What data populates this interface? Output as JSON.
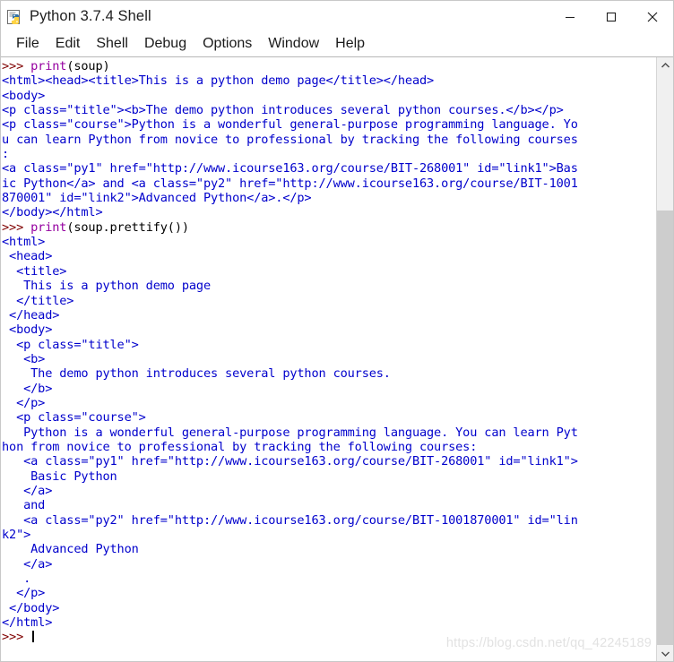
{
  "window": {
    "title": "Python 3.7.4 Shell",
    "icon": "python-idle-icon",
    "controls": [
      {
        "name": "minimize-button",
        "glyph": "—"
      },
      {
        "name": "maximize-button",
        "glyph": "□"
      },
      {
        "name": "close-button",
        "glyph": "✕"
      }
    ]
  },
  "menubar": {
    "items": [
      {
        "label": "File"
      },
      {
        "label": "Edit"
      },
      {
        "label": "Shell"
      },
      {
        "label": "Debug"
      },
      {
        "label": "Options"
      },
      {
        "label": "Window"
      },
      {
        "label": "Help"
      }
    ]
  },
  "scrollbar": {
    "up_arrow_glyph": "⌃",
    "down_arrow_glyph": "⌄",
    "thumb_top_pct": 24,
    "thumb_height_pct": 76
  },
  "watermark": {
    "text": "https://blog.csdn.net/qq_42245189"
  },
  "colors": {
    "prompt": "#7f0000",
    "keyword": "#9500a0",
    "output": "#0000cc",
    "plain": "#000000",
    "background": "#ffffff"
  },
  "shell": {
    "lines": [
      {
        "type": "input",
        "prompt": ">>> ",
        "kw": "print",
        "rest": "(soup)"
      },
      {
        "type": "output",
        "text": "<html><head><title>This is a python demo page</title></head>"
      },
      {
        "type": "output",
        "text": "<body>"
      },
      {
        "type": "output",
        "text": "<p class=\"title\"><b>The demo python introduces several python courses.</b></p>"
      },
      {
        "type": "output",
        "text": "<p class=\"course\">Python is a wonderful general-purpose programming language. Yo"
      },
      {
        "type": "output",
        "text": "u can learn Python from novice to professional by tracking the following courses"
      },
      {
        "type": "output",
        "text": ":"
      },
      {
        "type": "output",
        "text": "<a class=\"py1\" href=\"http://www.icourse163.org/course/BIT-268001\" id=\"link1\">Bas"
      },
      {
        "type": "output",
        "text": "ic Python</a> and <a class=\"py2\" href=\"http://www.icourse163.org/course/BIT-1001"
      },
      {
        "type": "output",
        "text": "870001\" id=\"link2\">Advanced Python</a>.</p>"
      },
      {
        "type": "output",
        "text": "</body></html>"
      },
      {
        "type": "input",
        "prompt": ">>> ",
        "kw": "print",
        "rest": "(soup.prettify())"
      },
      {
        "type": "output",
        "text": "<html>"
      },
      {
        "type": "output",
        "text": " <head>"
      },
      {
        "type": "output",
        "text": "  <title>"
      },
      {
        "type": "output",
        "text": "   This is a python demo page"
      },
      {
        "type": "output",
        "text": "  </title>"
      },
      {
        "type": "output",
        "text": " </head>"
      },
      {
        "type": "output",
        "text": " <body>"
      },
      {
        "type": "output",
        "text": "  <p class=\"title\">"
      },
      {
        "type": "output",
        "text": "   <b>"
      },
      {
        "type": "output",
        "text": "    The demo python introduces several python courses."
      },
      {
        "type": "output",
        "text": "   </b>"
      },
      {
        "type": "output",
        "text": "  </p>"
      },
      {
        "type": "output",
        "text": "  <p class=\"course\">"
      },
      {
        "type": "output",
        "text": "   Python is a wonderful general-purpose programming language. You can learn Pyt"
      },
      {
        "type": "output",
        "text": "hon from novice to professional by tracking the following courses:"
      },
      {
        "type": "output",
        "text": "   <a class=\"py1\" href=\"http://www.icourse163.org/course/BIT-268001\" id=\"link1\">"
      },
      {
        "type": "output",
        "text": "    Basic Python"
      },
      {
        "type": "output",
        "text": "   </a>"
      },
      {
        "type": "output",
        "text": "   and"
      },
      {
        "type": "output",
        "text": "   <a class=\"py2\" href=\"http://www.icourse163.org/course/BIT-1001870001\" id=\"lin"
      },
      {
        "type": "output",
        "text": "k2\">"
      },
      {
        "type": "output",
        "text": "    Advanced Python"
      },
      {
        "type": "output",
        "text": "   </a>"
      },
      {
        "type": "output",
        "text": "   ."
      },
      {
        "type": "output",
        "text": "  </p>"
      },
      {
        "type": "output",
        "text": " </body>"
      },
      {
        "type": "output",
        "text": "</html>"
      },
      {
        "type": "input",
        "prompt": ">>> ",
        "kw": "",
        "rest": "",
        "cursor": true
      }
    ]
  }
}
